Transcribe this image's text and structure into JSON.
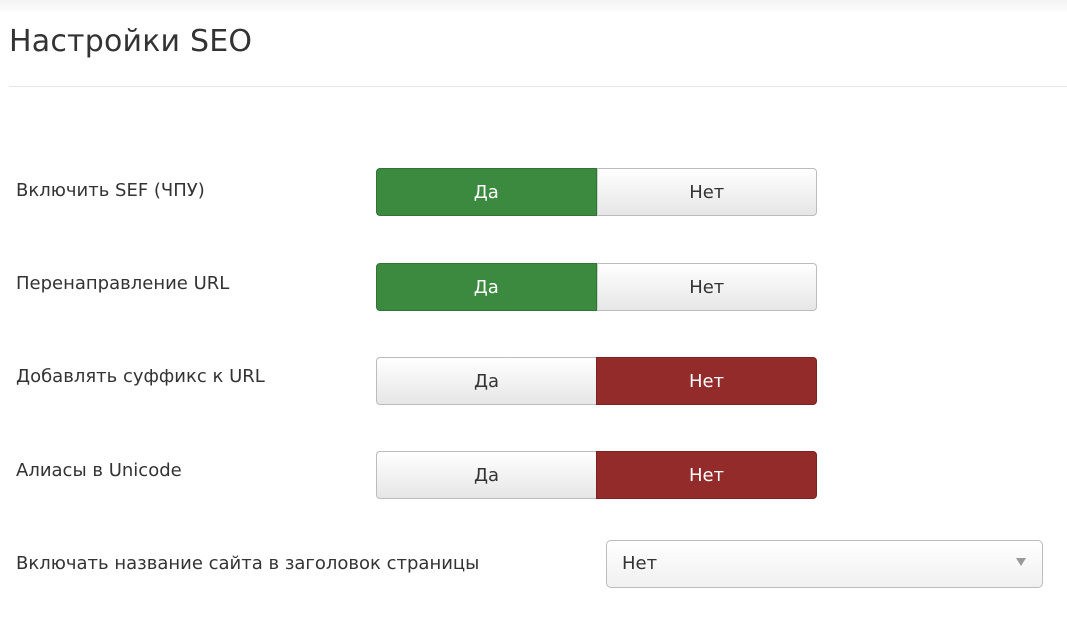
{
  "page": {
    "title": "Настройки SEO"
  },
  "settings": [
    {
      "label": "Включить SEF (ЧПУ)",
      "yes_label": "Да",
      "no_label": "Нет",
      "selected": "yes",
      "active_color": "#3c8a3f"
    },
    {
      "label": "Перенаправление URL",
      "yes_label": "Да",
      "no_label": "Нет",
      "selected": "yes",
      "active_color": "#3c8a3f"
    },
    {
      "label": "Добавлять суффикс к URL",
      "yes_label": "Да",
      "no_label": "Нет",
      "selected": "no",
      "active_color": "#922b29"
    },
    {
      "label": "Алиасы в Unicode",
      "yes_label": "Да",
      "no_label": "Нет",
      "selected": "no",
      "active_color": "#922b29"
    }
  ],
  "site_name_in_title": {
    "label": "Включать название сайта в заголовок страницы",
    "value": "Нет",
    "icon": "chevron-down-icon"
  }
}
